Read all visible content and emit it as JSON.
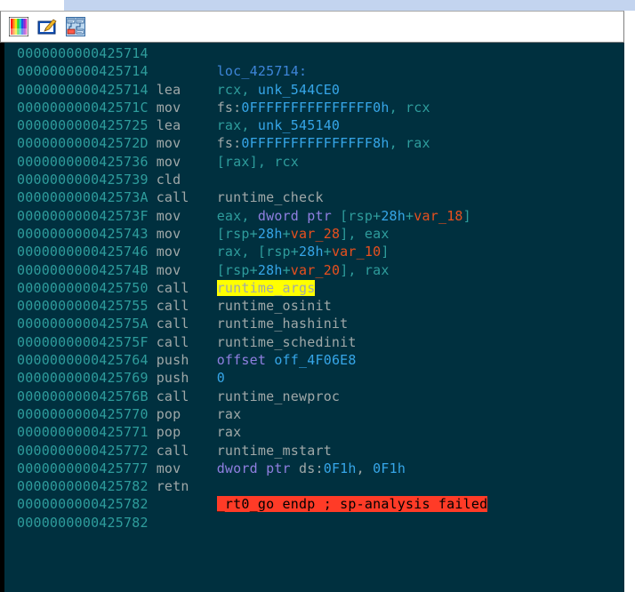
{
  "app": {
    "title": "IDA Pro disassembly view",
    "background_color": "#00303f",
    "address_color": "#2e9c9c",
    "mnemonic_color": "#9fa8a8",
    "symbol_color": "#36a6e8",
    "keyword_color": "#8f7fe0",
    "variable_color": "#e8501e",
    "label_color": "#3d85d8",
    "highlight_yellow": "#ffff00",
    "highlight_red": "#ff3b27"
  },
  "toolbar": {
    "buttons": [
      {
        "name": "color-palette-icon",
        "tooltip": "Colors"
      },
      {
        "name": "pencil-edit-icon",
        "tooltip": "Edit"
      },
      {
        "name": "graph-view-icon",
        "tooltip": "Graph view"
      }
    ]
  },
  "disassembly": {
    "lines": [
      {
        "address": "0000000000425714",
        "mnemonic": "",
        "operands": []
      },
      {
        "address": "0000000000425714",
        "mnemonic": "",
        "operands": [
          {
            "t": "loc_425714:",
            "c": "lbl"
          }
        ]
      },
      {
        "address": "0000000000425714",
        "mnemonic": "lea",
        "operands": [
          {
            "t": "rcx, ",
            "c": "reg"
          },
          {
            "t": "unk_544CE0",
            "c": "sym"
          }
        ]
      },
      {
        "address": "000000000042571C",
        "mnemonic": "mov",
        "operands": [
          {
            "t": "fs:",
            "c": "seg"
          },
          {
            "t": "0FFFFFFFFFFFFFFF0h",
            "c": "num"
          },
          {
            "t": ", rcx",
            "c": "reg"
          }
        ]
      },
      {
        "address": "0000000000425725",
        "mnemonic": "lea",
        "operands": [
          {
            "t": "rax, ",
            "c": "reg"
          },
          {
            "t": "unk_545140",
            "c": "sym"
          }
        ]
      },
      {
        "address": "000000000042572D",
        "mnemonic": "mov",
        "operands": [
          {
            "t": "fs:",
            "c": "seg"
          },
          {
            "t": "0FFFFFFFFFFFFFFF8h",
            "c": "num"
          },
          {
            "t": ", rax",
            "c": "reg"
          }
        ]
      },
      {
        "address": "0000000000425736",
        "mnemonic": "mov",
        "operands": [
          {
            "t": "[rax], rcx",
            "c": "reg"
          }
        ]
      },
      {
        "address": "0000000000425739",
        "mnemonic": "cld",
        "operands": []
      },
      {
        "address": "000000000042573A",
        "mnemonic": "call",
        "operands": [
          {
            "t": "runtime_check",
            "c": "plain"
          }
        ]
      },
      {
        "address": "000000000042573F",
        "mnemonic": "mov",
        "operands": [
          {
            "t": "eax, ",
            "c": "reg"
          },
          {
            "t": "dword ptr ",
            "c": "kw"
          },
          {
            "t": "[rsp+",
            "c": "reg"
          },
          {
            "t": "28h",
            "c": "num"
          },
          {
            "t": "+",
            "c": "reg"
          },
          {
            "t": "var_18",
            "c": "var"
          },
          {
            "t": "]",
            "c": "reg"
          }
        ]
      },
      {
        "address": "0000000000425743",
        "mnemonic": "mov",
        "operands": [
          {
            "t": "[rsp+",
            "c": "reg"
          },
          {
            "t": "28h",
            "c": "num"
          },
          {
            "t": "+",
            "c": "reg"
          },
          {
            "t": "var_28",
            "c": "var"
          },
          {
            "t": "], eax",
            "c": "reg"
          }
        ]
      },
      {
        "address": "0000000000425746",
        "mnemonic": "mov",
        "operands": [
          {
            "t": "rax, [rsp+",
            "c": "reg"
          },
          {
            "t": "28h",
            "c": "num"
          },
          {
            "t": "+",
            "c": "reg"
          },
          {
            "t": "var_10",
            "c": "var"
          },
          {
            "t": "]",
            "c": "reg"
          }
        ]
      },
      {
        "address": "000000000042574B",
        "mnemonic": "mov",
        "operands": [
          {
            "t": "[rsp+",
            "c": "reg"
          },
          {
            "t": "28h",
            "c": "num"
          },
          {
            "t": "+",
            "c": "reg"
          },
          {
            "t": "var_20",
            "c": "var"
          },
          {
            "t": "], rax",
            "c": "reg"
          }
        ]
      },
      {
        "address": "0000000000425750",
        "mnemonic": "call",
        "operands": [
          {
            "t": "runtime_args",
            "c": "hl-yellow"
          }
        ]
      },
      {
        "address": "0000000000425755",
        "mnemonic": "call",
        "operands": [
          {
            "t": "runtime_osinit",
            "c": "plain"
          }
        ]
      },
      {
        "address": "000000000042575A",
        "mnemonic": "call",
        "operands": [
          {
            "t": "runtime_hashinit",
            "c": "plain"
          }
        ]
      },
      {
        "address": "000000000042575F",
        "mnemonic": "call",
        "operands": [
          {
            "t": "runtime_schedinit",
            "c": "plain"
          }
        ]
      },
      {
        "address": "0000000000425764",
        "mnemonic": "push",
        "operands": [
          {
            "t": "offset ",
            "c": "kw"
          },
          {
            "t": "off_4F06E8",
            "c": "sym"
          }
        ]
      },
      {
        "address": "0000000000425769",
        "mnemonic": "push",
        "operands": [
          {
            "t": "0",
            "c": "num"
          }
        ]
      },
      {
        "address": "000000000042576B",
        "mnemonic": "call",
        "operands": [
          {
            "t": "runtime_newproc",
            "c": "plain"
          }
        ]
      },
      {
        "address": "0000000000425770",
        "mnemonic": "pop",
        "operands": [
          {
            "t": "rax",
            "c": "plain"
          }
        ]
      },
      {
        "address": "0000000000425771",
        "mnemonic": "pop",
        "operands": [
          {
            "t": "rax",
            "c": "plain"
          }
        ]
      },
      {
        "address": "0000000000425772",
        "mnemonic": "call",
        "operands": [
          {
            "t": "runtime_mstart",
            "c": "plain"
          }
        ]
      },
      {
        "address": "0000000000425777",
        "mnemonic": "mov",
        "operands": [
          {
            "t": "dword ptr ",
            "c": "kw"
          },
          {
            "t": "ds:",
            "c": "seg"
          },
          {
            "t": "0F1h",
            "c": "num"
          },
          {
            "t": ", ",
            "c": "plain"
          },
          {
            "t": "0F1h",
            "c": "num"
          }
        ]
      },
      {
        "address": "0000000000425782",
        "mnemonic": "retn",
        "operands": []
      },
      {
        "address": "0000000000425782",
        "mnemonic": "",
        "operands": [
          {
            "t": "_rt0_go endp ; sp-analysis failed",
            "c": "hl-red"
          }
        ]
      },
      {
        "address": "0000000000425782",
        "mnemonic": "",
        "operands": []
      }
    ]
  }
}
